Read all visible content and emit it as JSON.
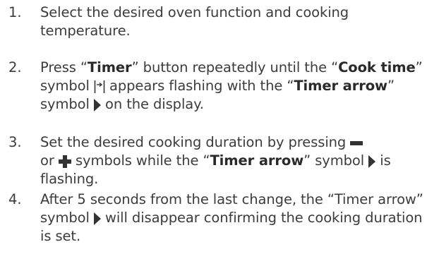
{
  "steps": [
    {
      "number": "1.",
      "text": "Select the desired oven function and cooking temperature."
    },
    {
      "number": "2.",
      "t1": "Press “",
      "b1": "Timer",
      "t2": "” button repeatedly until the “",
      "b2": "Cook time",
      "t3": "” symbol ",
      "t4": " appears flashing with the “",
      "b3": "Timer arrow",
      "t5": "” symbol ",
      "t6": " on the display."
    },
    {
      "number": "3.",
      "t1": "Set the desired cooking duration by pressing ",
      "t2": " or ",
      "t3": " symbols while the “",
      "b1": "Timer arrow",
      "t4": "” symbol ",
      "t5": " is flashing."
    },
    {
      "number": "4.",
      "t1": "After 5 seconds from the last change, the “Timer arrow” symbol ",
      "t2": " will disappear confirming the cooking duration is set."
    }
  ],
  "icons": {
    "cook_time": "cook-time-icon",
    "timer_arrow": "timer-arrow-icon",
    "minus": "minus-icon",
    "plus": "plus-icon",
    "icon_color": "#333333"
  }
}
